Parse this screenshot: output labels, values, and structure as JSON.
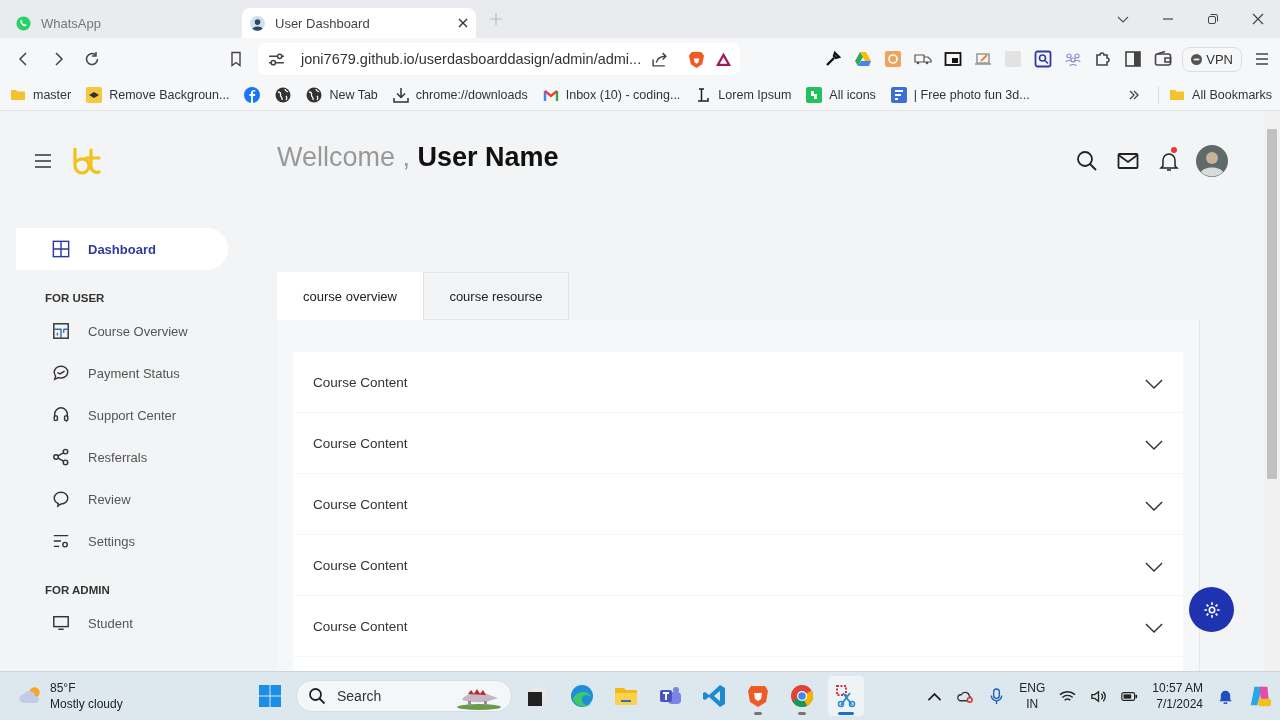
{
  "browser": {
    "tabs": [
      {
        "title": "WhatsApp",
        "kind": "whatsapp",
        "selected": false
      },
      {
        "title": "User Dashboard",
        "kind": "person",
        "selected": true
      }
    ],
    "address": "joni7679.github.io/userdasboarddasign/admin/admi...",
    "vpn_label": "VPN",
    "bookmarks": [
      {
        "label": "master",
        "kind": "folder"
      },
      {
        "label": "Remove Backgroun...",
        "kind": "layers"
      },
      {
        "kind": "facebook"
      },
      {
        "kind": "globe"
      },
      {
        "label": "New Tab",
        "kind": "globe"
      },
      {
        "label": "chrome://downloads",
        "kind": "download"
      },
      {
        "label": "Inbox (10) - coding...",
        "kind": "mail"
      },
      {
        "label": "Lorem Ipsum",
        "kind": "letter"
      },
      {
        "label": "All icons",
        "kind": "green"
      },
      {
        "label": "| Free photo fun 3d...",
        "kind": "form"
      }
    ],
    "all_bookmarks": "All Bookmarks"
  },
  "page": {
    "welcome": "Wellcome ,",
    "user_name": "User Name",
    "notification_dot": true,
    "sidebar": {
      "main": [
        {
          "label": "Dashboard",
          "kind": "grid",
          "selected": true
        }
      ],
      "sections": [
        {
          "heading": "FOR USER",
          "items": [
            {
              "label": "Course Overview",
              "kind": "layout",
              "selected": false
            },
            {
              "label": "Payment Status",
              "kind": "chat-check",
              "selected": false
            },
            {
              "label": "Support Center",
              "kind": "headset",
              "selected": false
            },
            {
              "label": "Resferrals",
              "kind": "share",
              "selected": false
            },
            {
              "label": "Review",
              "kind": "bubble",
              "selected": false
            },
            {
              "label": "Settings",
              "kind": "sliders",
              "selected": false
            }
          ]
        },
        {
          "heading": "FOR ADMIN",
          "items": [
            {
              "label": "Student",
              "kind": "monitor",
              "selected": false
            }
          ]
        }
      ]
    },
    "tabs": [
      {
        "label": "course overview",
        "selected": true
      },
      {
        "label": "course resourse",
        "selected": false
      }
    ],
    "accordion": [
      {
        "title": "Course Content",
        "expanded": false
      },
      {
        "title": "Course Content",
        "expanded": false
      },
      {
        "title": "Course Content",
        "expanded": false
      },
      {
        "title": "Course Content",
        "expanded": false
      },
      {
        "title": "Course Content",
        "expanded": false
      }
    ]
  },
  "taskbar": {
    "temperature": "85°F",
    "weather": "Mostly cloudy",
    "search_placeholder": "Search",
    "apps": [
      {
        "kind": "taskview",
        "running": false,
        "selected": false
      },
      {
        "kind": "edge",
        "running": false,
        "selected": false
      },
      {
        "kind": "files",
        "running": false,
        "selected": false
      },
      {
        "kind": "teams",
        "running": false,
        "selected": false
      },
      {
        "kind": "code",
        "running": false,
        "selected": false
      },
      {
        "kind": "lion",
        "running": true,
        "selected": false
      },
      {
        "kind": "chrome",
        "running": true,
        "selected": false
      },
      {
        "kind": "snip",
        "running": true,
        "selected": true
      }
    ],
    "language": "ENG",
    "region": "IN",
    "time": "10:57 AM",
    "date": "7/1/2024"
  }
}
